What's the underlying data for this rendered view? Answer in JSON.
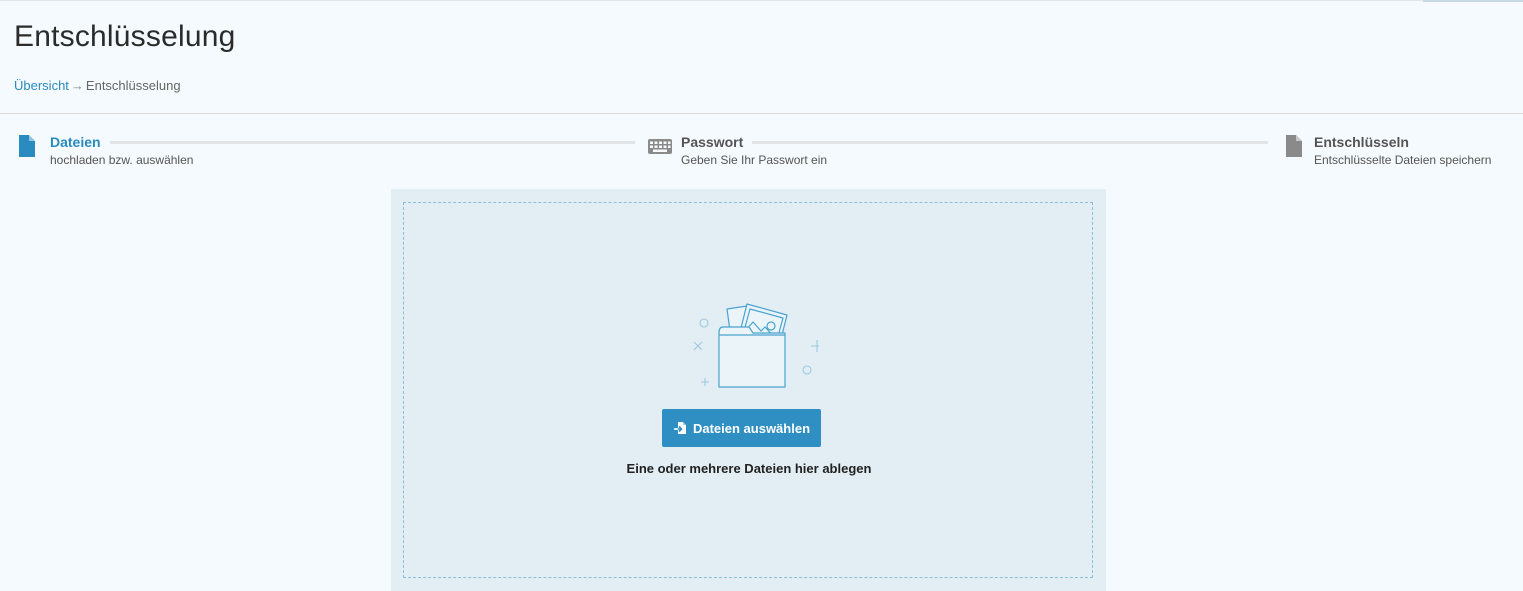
{
  "page": {
    "title": "Entschlüsselung"
  },
  "breadcrumb": {
    "home_label": "Übersicht",
    "separator": "→",
    "current_label": "Entschlüsselung"
  },
  "steps": [
    {
      "title": "Dateien",
      "subtitle": "hochladen bzw. auswählen",
      "icon": "file-icon",
      "active": true
    },
    {
      "title": "Passwort",
      "subtitle": "Geben Sie Ihr Passwort ein",
      "icon": "keyboard-icon",
      "active": false
    },
    {
      "title": "Entschlüsseln",
      "subtitle": "Entschlüsselte Dateien speichern",
      "icon": "file-icon",
      "active": false
    }
  ],
  "dropzone": {
    "button_label": "Dateien auswählen",
    "hint": "Eine oder mehrere Dateien hier ablegen",
    "illustration_icon": "folder-with-images-icon"
  },
  "colors": {
    "accent": "#2a8bc0",
    "button": "#2f8fc3",
    "background": "#f4fafd",
    "dropzone_bg": "#e2eef4",
    "inactive": "#8a8a8a"
  }
}
